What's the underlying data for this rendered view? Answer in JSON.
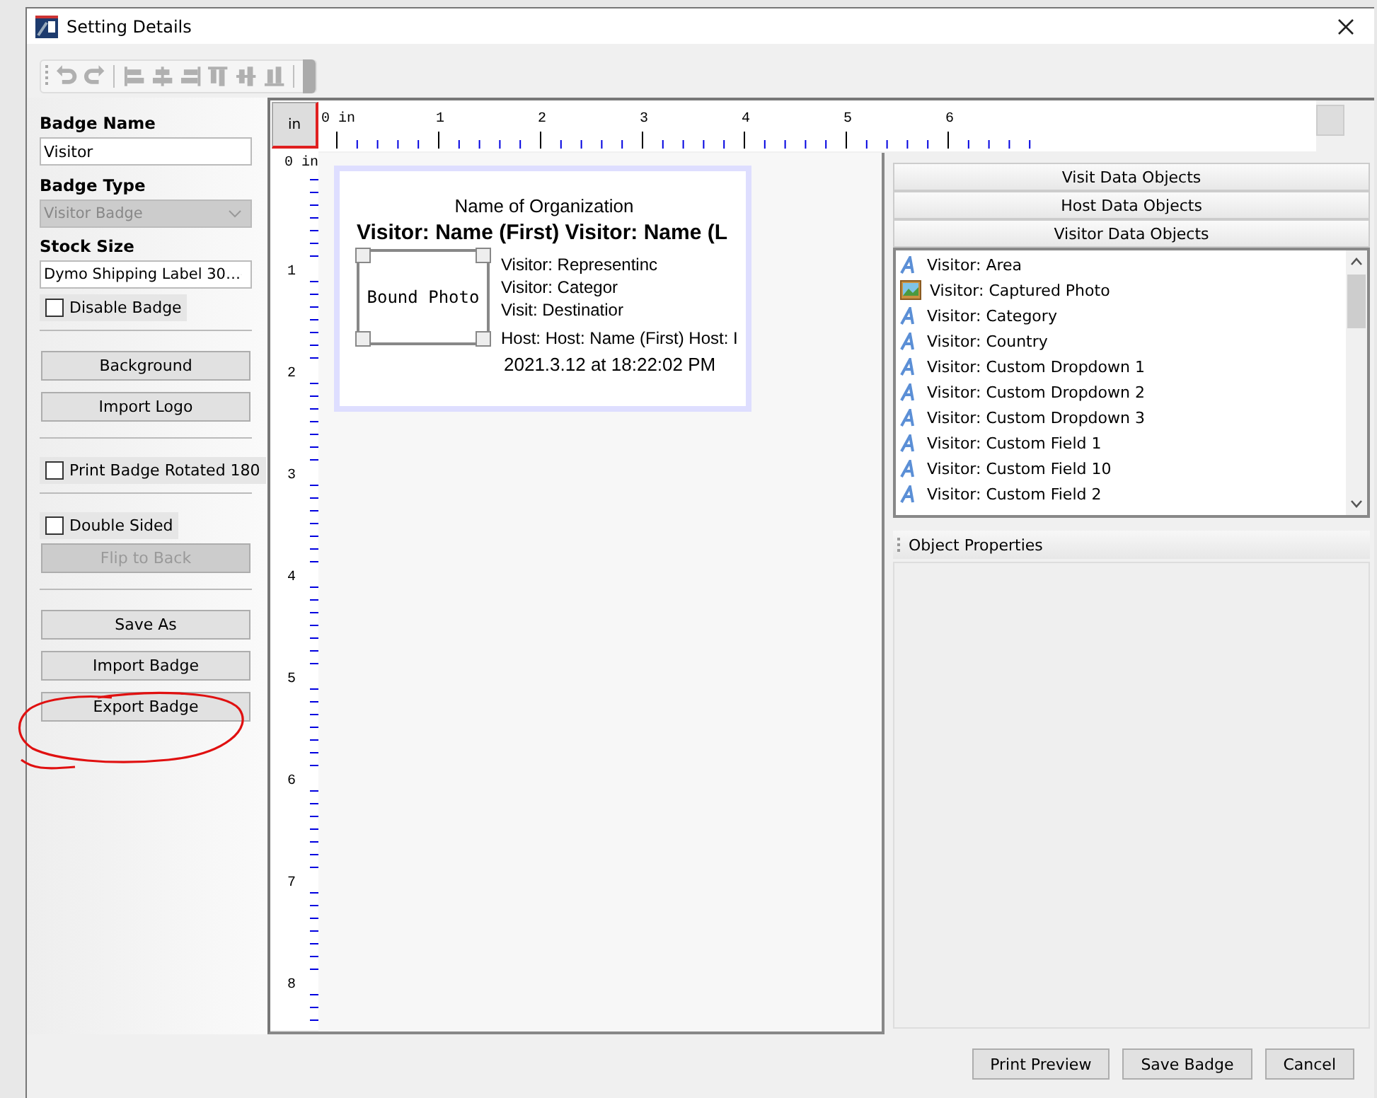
{
  "window": {
    "title": "Setting Details"
  },
  "left_panel": {
    "badge_name": {
      "label": "Badge Name",
      "value": "Visitor"
    },
    "badge_type": {
      "label": "Badge Type",
      "value": "Visitor Badge",
      "disabled": true
    },
    "stock_size": {
      "label": "Stock Size",
      "value": "Dymo Shipping Label 30…",
      "disabled": false
    },
    "controls": [
      {
        "kind": "checkbox",
        "label": "Disable Badge",
        "checked": false
      },
      {
        "kind": "divider"
      },
      {
        "kind": "button",
        "label": "Background",
        "disabled": false
      },
      {
        "kind": "button",
        "label": "Import Logo",
        "disabled": false
      },
      {
        "kind": "divider"
      },
      {
        "kind": "checkbox",
        "label": "Print Badge Rotated 180",
        "checked": false
      },
      {
        "kind": "divider"
      },
      {
        "kind": "checkbox",
        "label": "Double Sided",
        "checked": false
      },
      {
        "kind": "button",
        "label": "Flip to Back",
        "disabled": true
      },
      {
        "kind": "divider"
      },
      {
        "kind": "button",
        "label": "Save As",
        "disabled": false
      },
      {
        "kind": "button",
        "label": "Import Badge",
        "disabled": false
      },
      {
        "kind": "button",
        "label": "Export Badge",
        "disabled": false
      }
    ]
  },
  "ruler": {
    "unit_button": "in",
    "horizontal": [
      "0 in",
      "1",
      "2",
      "3",
      "4",
      "5",
      "6"
    ],
    "vertical": [
      "0 in",
      "1",
      "2",
      "3",
      "4",
      "5",
      "6",
      "7",
      "8"
    ]
  },
  "badge": {
    "organization": "Name of Organization",
    "name_line": "Visitor: Name (First) Visitor: Name (L",
    "photo_label": "Bound Photo",
    "fields": [
      "Visitor: Representinc",
      "Visitor: Categor",
      "Visit: Destinatior"
    ],
    "host_line": "Host:  Host: Name (First) Host: I",
    "date": "2021.3.12 at 18:22:02 PM"
  },
  "right_panel": {
    "sections": [
      "Visit Data Objects",
      "Host Data Objects",
      "Visitor Data Objects"
    ],
    "objects": [
      {
        "label": "Visitor: Area",
        "kind": "text"
      },
      {
        "label": "Visitor: Captured Photo",
        "kind": "photo"
      },
      {
        "label": "Visitor: Category",
        "kind": "text"
      },
      {
        "label": "Visitor: Country",
        "kind": "text"
      },
      {
        "label": "Visitor: Custom Dropdown 1",
        "kind": "text"
      },
      {
        "label": "Visitor: Custom Dropdown 2",
        "kind": "text"
      },
      {
        "label": "Visitor: Custom Dropdown 3",
        "kind": "text"
      },
      {
        "label": "Visitor: Custom Field 1",
        "kind": "text"
      },
      {
        "label": "Visitor: Custom Field 10",
        "kind": "text"
      },
      {
        "label": "Visitor: Custom Field 2",
        "kind": "text"
      }
    ],
    "object_properties": "Object Properties"
  },
  "footer_buttons": [
    "Print Preview",
    "Save Badge",
    "Cancel"
  ]
}
